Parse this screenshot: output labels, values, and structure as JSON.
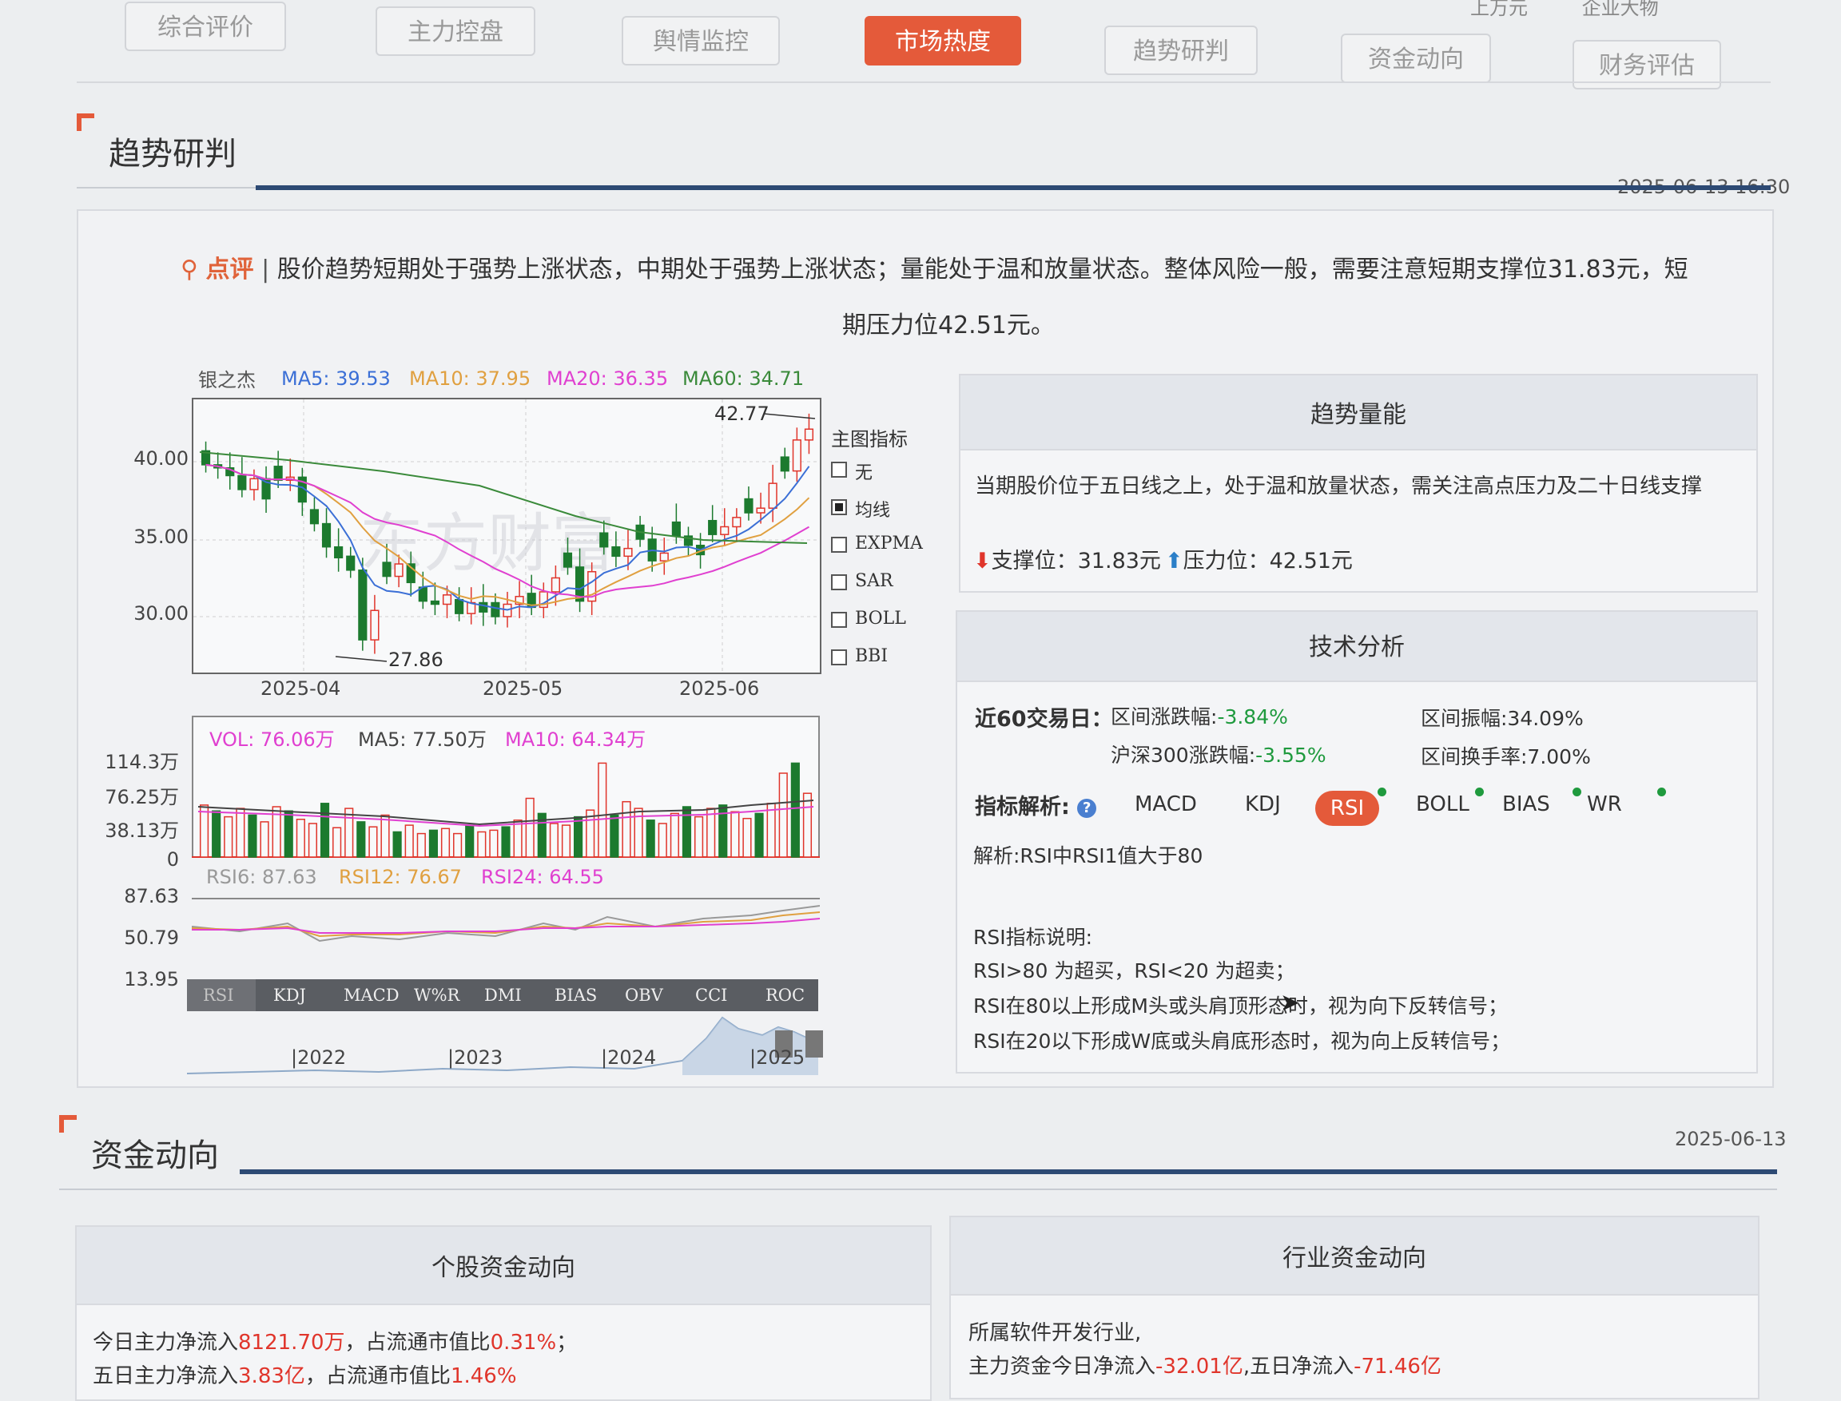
{
  "tabs": [
    "综合评价",
    "主力控盘",
    "舆情监控",
    "市场热度",
    "趋势研判",
    "资金动向",
    "财务评估"
  ],
  "active_tab": "市场热度",
  "top_right": [
    "上万元",
    "企业大物"
  ],
  "trend": {
    "title": "趋势研判",
    "date": "2025-06-13 16:30",
    "comment_label": "点评",
    "comment_text": "股价趋势短期处于强势上涨状态，中期处于强势上涨状态；量能处于温和放量状态。整体风险一般，需要注意短期支撑位31.83元，短",
    "comment_text_2": "期压力位42.51元。",
    "stock_name": "银之杰",
    "ma": [
      {
        "label": "MA5: 39.53",
        "color": "#3b6fd6"
      },
      {
        "label": "MA10: 37.95",
        "color": "#e0a040"
      },
      {
        "label": "MA20: 36.35",
        "color": "#e040d0"
      },
      {
        "label": "MA60: 34.71",
        "color": "#3a8a3a"
      }
    ],
    "watermark": "东方财富",
    "price_high": "42.77",
    "price_low": "27.86",
    "price_axis": [
      "40.00",
      "35.00",
      "30.00"
    ],
    "date_axis": [
      "2025-04",
      "2025-05",
      "2025-06"
    ],
    "main_indicator_title": "主图指标",
    "main_indicators": [
      {
        "label": "无",
        "checked": false
      },
      {
        "label": "均线",
        "checked": true
      },
      {
        "label": "EXPMA",
        "checked": false
      },
      {
        "label": "SAR",
        "checked": false
      },
      {
        "label": "BOLL",
        "checked": false
      },
      {
        "label": "BBI",
        "checked": false
      }
    ],
    "vol_legend": [
      {
        "label": "VOL: 76.06万",
        "color": "#e040d0"
      },
      {
        "label": "MA5: 77.50万",
        "color": "#444"
      },
      {
        "label": "MA10: 64.34万",
        "color": "#e040d0"
      }
    ],
    "vol_axis": [
      "114.3万",
      "76.25万",
      "38.13万",
      "0"
    ],
    "rsi_legend": [
      {
        "label": "RSI6: 87.63",
        "color": "#999"
      },
      {
        "label": "RSI12: 76.67",
        "color": "#e0a040"
      },
      {
        "label": "RSI24: 64.55",
        "color": "#e040d0"
      }
    ],
    "rsi_axis": [
      "87.63",
      "50.79",
      "13.95"
    ],
    "sub_tabs": [
      "RSI",
      "KDJ",
      "MACD",
      "W%R",
      "DMI",
      "BIAS",
      "OBV",
      "CCI",
      "ROC"
    ],
    "overview_years": [
      "2022",
      "2023",
      "2024",
      "2025"
    ]
  },
  "trend_volume": {
    "title": "趋势量能",
    "text": "当期股价位于五日线之上，处于温和放量状态，需关注高点压力及二十日线支撑",
    "support": "支撑位：31.83元",
    "pressure": "压力位：42.51元"
  },
  "tech": {
    "title": "技术分析",
    "period_label": "近60交易日：",
    "range_change_label": "区间涨跌幅:",
    "range_change_value": "-3.84%",
    "amplitude": "区间振幅:34.09%",
    "hs300_label": "沪深300涨跌幅:",
    "hs300_value": "-3.55%",
    "turnover": "区间换手率:7.00%",
    "indicator_label": "指标解析:",
    "indicators": [
      "MACD",
      "KDJ",
      "RSI",
      "BOLL",
      "BIAS",
      "WR"
    ],
    "active_indicator": "RSI",
    "analysis": "解析:RSI中RSI1值大于80",
    "rsi_title": "RSI指标说明:",
    "rsi_lines": [
      "RSI>80 为超买，RSI<20 为超卖；",
      "RSI在80以上形成M头或头肩顶形态时，视为向下反转信号；",
      "RSI在20以下形成W底或头肩底形态时，视为向上反转信号；"
    ]
  },
  "funds": {
    "title": "资金动向",
    "date": "2025-06-13",
    "stock_box_title": "个股资金动向",
    "stock_line1_a": "今日主力净流入",
    "stock_line1_v": "8121.70万",
    "stock_line1_b": "，占流通市值比",
    "stock_line1_p": "0.31%",
    "stock_line1_c": "；",
    "stock_line2_a": "五日主力净流入",
    "stock_line2_v": "3.83亿",
    "stock_line2_b": "，占流通市值比",
    "stock_line2_p": "1.46%",
    "industry_box_title": "行业资金动向",
    "industry_line1": "所属软件开发行业,",
    "industry_line2_a": "主力资金今日净流入",
    "industry_line2_v1": "-32.01亿",
    "industry_line2_b": ",五日净流入",
    "industry_line2_v2": "-71.46亿"
  }
}
